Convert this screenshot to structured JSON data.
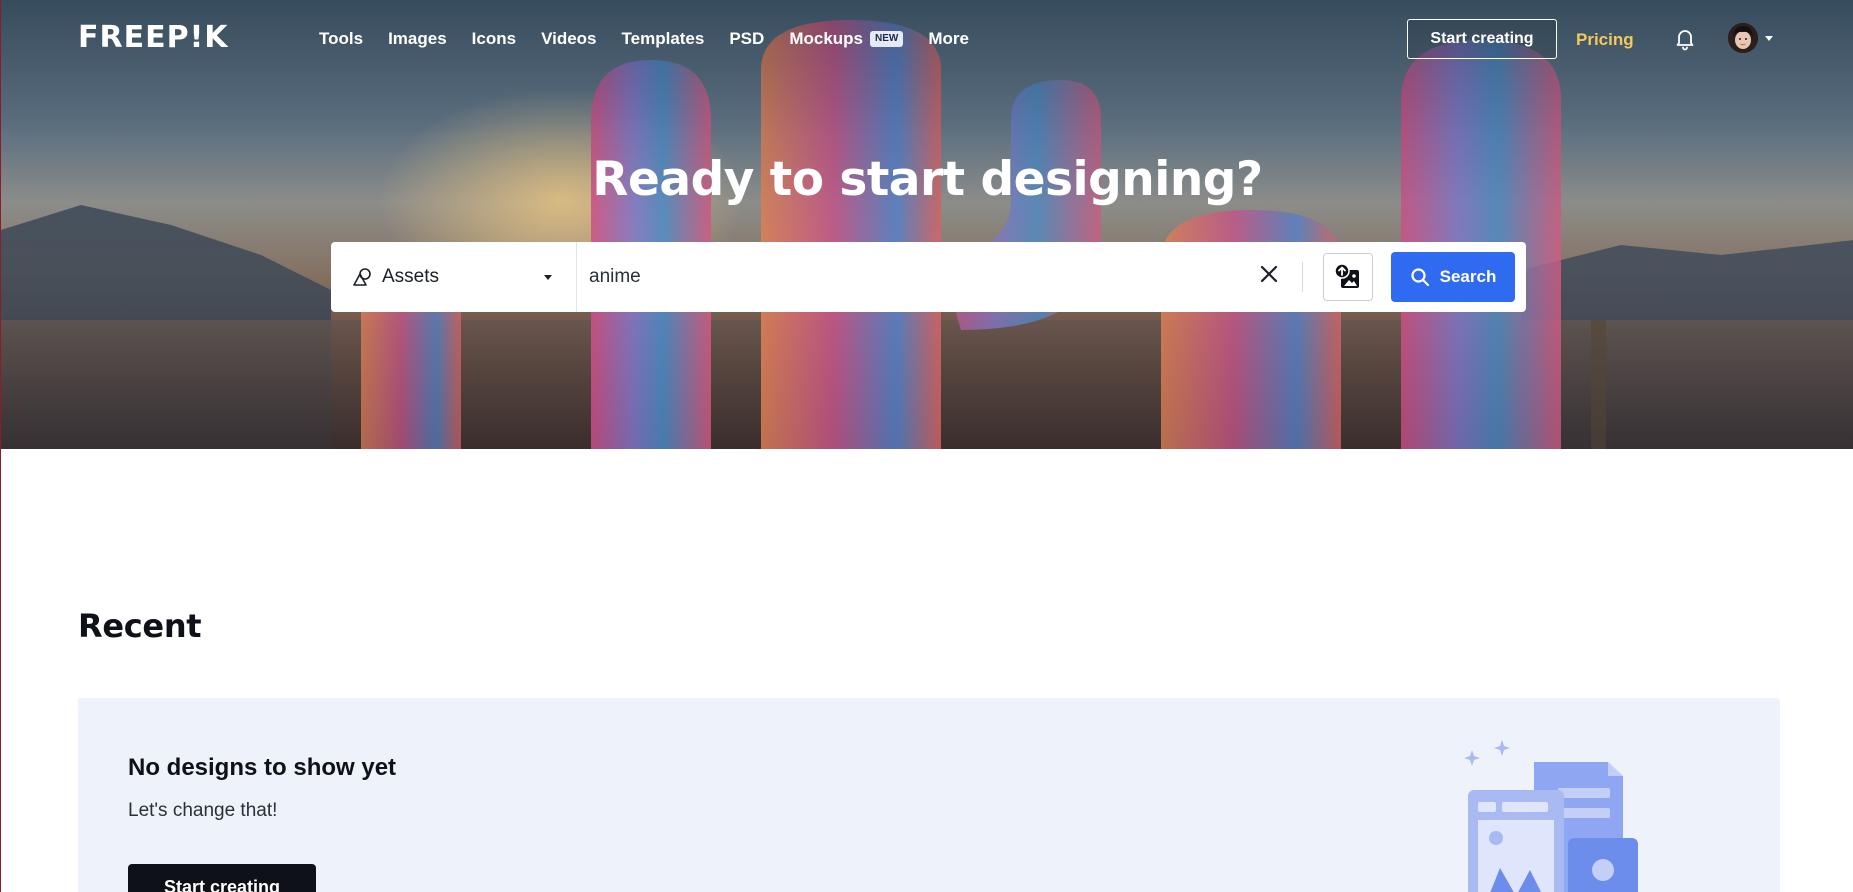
{
  "nav": {
    "logo": "FREEP!K",
    "links": [
      {
        "label": "Tools"
      },
      {
        "label": "Images"
      },
      {
        "label": "Icons"
      },
      {
        "label": "Videos"
      },
      {
        "label": "Templates"
      },
      {
        "label": "PSD"
      },
      {
        "label": "Mockups",
        "badge": "NEW"
      },
      {
        "label": "More"
      }
    ],
    "start_creating": "Start creating",
    "pricing": "Pricing",
    "icons": {
      "bell": "bell-icon",
      "avatar": "avatar",
      "caret": "chevron-down-icon"
    }
  },
  "hero": {
    "title": "Ready to start designing?"
  },
  "search": {
    "asset_type": "Assets",
    "query": "anime",
    "button": "Search",
    "icons": {
      "assets": "shapes-icon",
      "clear": "close-icon",
      "image_search": "image-search-icon",
      "search": "search-icon"
    }
  },
  "recent": {
    "title": "Recent",
    "empty_title": "No designs to show yet",
    "empty_subtitle": "Let's change that!",
    "empty_button": "Start creating"
  },
  "colors": {
    "accent": "#2f6bf0",
    "pricing": "#f5c85a",
    "card_bg": "#eef2fb",
    "dark_button": "#0e1117"
  }
}
